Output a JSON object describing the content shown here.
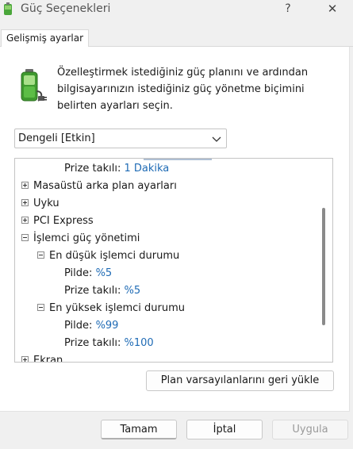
{
  "window": {
    "title": "Güç Seçenekleri",
    "help": "?",
    "close": "✕"
  },
  "tab": {
    "label": "Gelişmiş ayarlar"
  },
  "description": "Özelleştirmek istediğiniz güç planını ve ardından bilgisayarınızın istediğiniz güç yönetme biçimini belirten ayarları seçin.",
  "plan_select": {
    "value": "Dengeli [Etkin]"
  },
  "tree": {
    "rows": [
      {
        "label": "Prize takılı:",
        "value": "1 Dakika"
      },
      {
        "label": "Masaüstü arka plan ayarları"
      },
      {
        "label": "Uyku"
      },
      {
        "label": "PCI Express"
      },
      {
        "label": "İşlemci güç yönetimi"
      },
      {
        "label": "En düşük işlemci durumu"
      },
      {
        "label": "Pilde:",
        "value": "%5"
      },
      {
        "label": "Prize takılı:",
        "value": "%5"
      },
      {
        "label": "En yüksek işlemci durumu"
      },
      {
        "label": "Pilde:",
        "value": "%99"
      },
      {
        "label": "Prize takılı:",
        "value": "%100"
      },
      {
        "label": "Ekran"
      }
    ]
  },
  "buttons": {
    "restore": "Plan varsayılanlarını geri yükle",
    "ok": "Tamam",
    "cancel": "İptal",
    "apply": "Uygula"
  }
}
